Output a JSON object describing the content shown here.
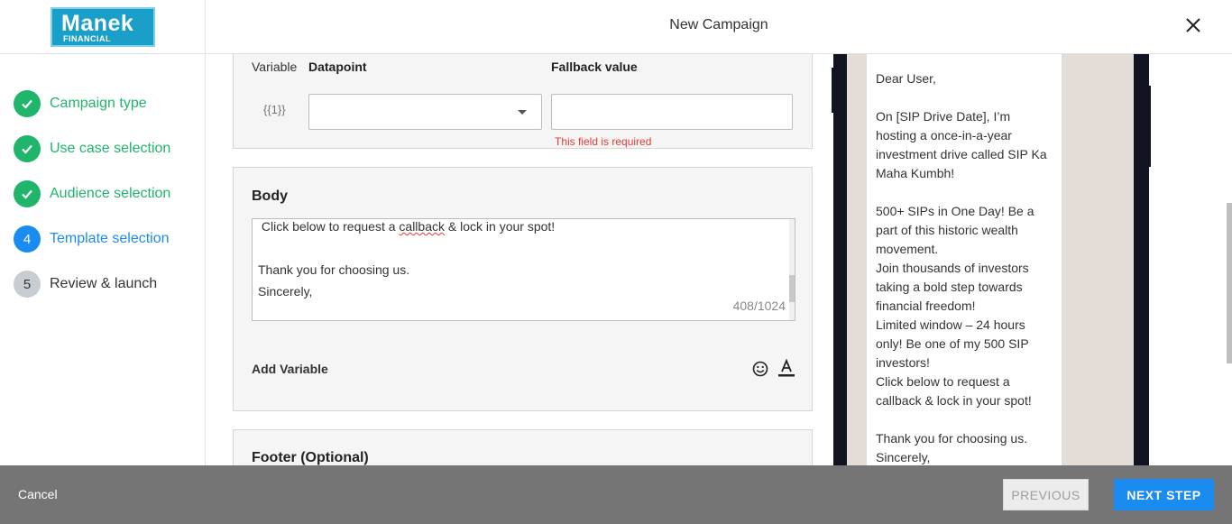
{
  "header": {
    "logo_main": "Manek",
    "logo_sub": "FINANCIAL",
    "title": "New Campaign"
  },
  "steps": [
    {
      "num": "",
      "label": "Campaign type",
      "state": "done"
    },
    {
      "num": "",
      "label": "Use case selection",
      "state": "done"
    },
    {
      "num": "",
      "label": "Audience selection",
      "state": "done"
    },
    {
      "num": "4",
      "label": "Template selection",
      "state": "active"
    },
    {
      "num": "5",
      "label": "Review & launch",
      "state": "todo"
    }
  ],
  "variables": {
    "col_variable": "Variable",
    "col_datapoint": "Datapoint",
    "col_fallback": "Fallback value",
    "token": "{{1}}",
    "datapoint_value": "",
    "fallback_value": "",
    "error": "This field is required"
  },
  "body": {
    "title": "Body",
    "line1_pre": " Click below to request a ",
    "line1_mark": "callback",
    "line1_post": " & lock in your spot!",
    "line2": "",
    "line3": "Thank you for choosing us.",
    "line4": "Sincerely,",
    "counter": "408/1024",
    "add_variable": "Add Variable"
  },
  "footer": {
    "title": "Footer (Optional)"
  },
  "preview": {
    "lines": [
      "Dear User,",
      "",
      "On [SIP Drive Date], I’m",
      "hosting a once-in-a-year",
      "investment drive called SIP Ka",
      "Maha Kumbh!",
      "",
      "500+ SIPs in One Day! Be a",
      "part of this historic wealth",
      "movement.",
      "Join thousands of investors",
      "taking a bold step towards",
      "financial freedom!",
      "Limited window – 24 hours",
      "only! Be one of my 500 SIP",
      "investors!",
      "Click below to request a",
      "callback & lock in your spot!",
      "",
      "Thank you for choosing us.",
      "Sincerely,"
    ]
  },
  "actions": {
    "cancel": "Cancel",
    "previous": "PREVIOUS",
    "next": "NEXT STEP"
  },
  "colors": {
    "success": "#1fb56b",
    "primary": "#1a8cf0",
    "error": "#e53935",
    "bottom_bar": "#757575"
  }
}
